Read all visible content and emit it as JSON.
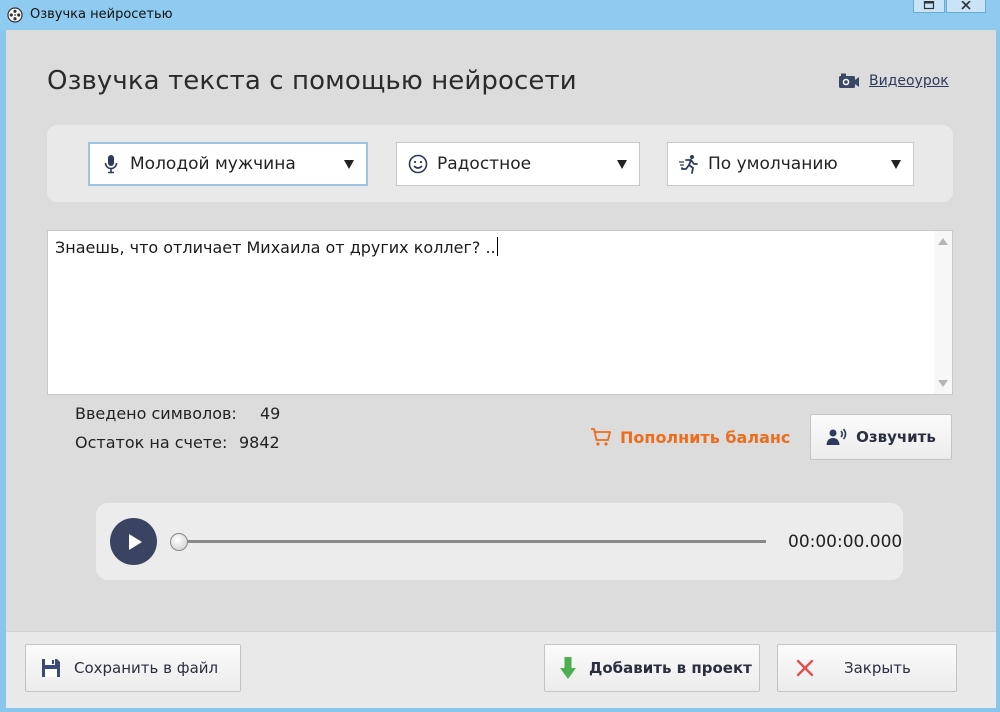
{
  "window": {
    "title": "Озвучка нейросетью",
    "icon": "film-reel-icon"
  },
  "header": {
    "title": "Озвучка текста с помощью нейросети",
    "video_tutorial_label": "Видеоурок"
  },
  "selectors": {
    "voice": {
      "value": "Молодой мужчина",
      "icon": "microphone-icon"
    },
    "emotion": {
      "value": "Радостное",
      "icon": "smiley-face-icon"
    },
    "speed": {
      "value": "По умолчанию",
      "icon": "running-man-icon"
    }
  },
  "editor": {
    "text": "Знаешь, что отличает Михаила от других коллег? .."
  },
  "stats": {
    "chars_label": "Введено символов:",
    "chars_value": "49",
    "balance_label": "Остаток на счете:",
    "balance_value": "9842"
  },
  "actions": {
    "topup_label": "Пополнить баланс",
    "voice_label": "Озвучить"
  },
  "player": {
    "time": "00:00:00.000",
    "progress": 0
  },
  "footer": {
    "save_label": "Сохранить в файл",
    "add_label": "Добавить в проект",
    "close_label": "Закрыть"
  },
  "colors": {
    "accent_orange": "#ec6d1d",
    "titlebar": "#8fcbf0",
    "play_button": "#3a4462",
    "add_arrow_green": "#4caf50",
    "close_x_red": "#e0504a"
  }
}
